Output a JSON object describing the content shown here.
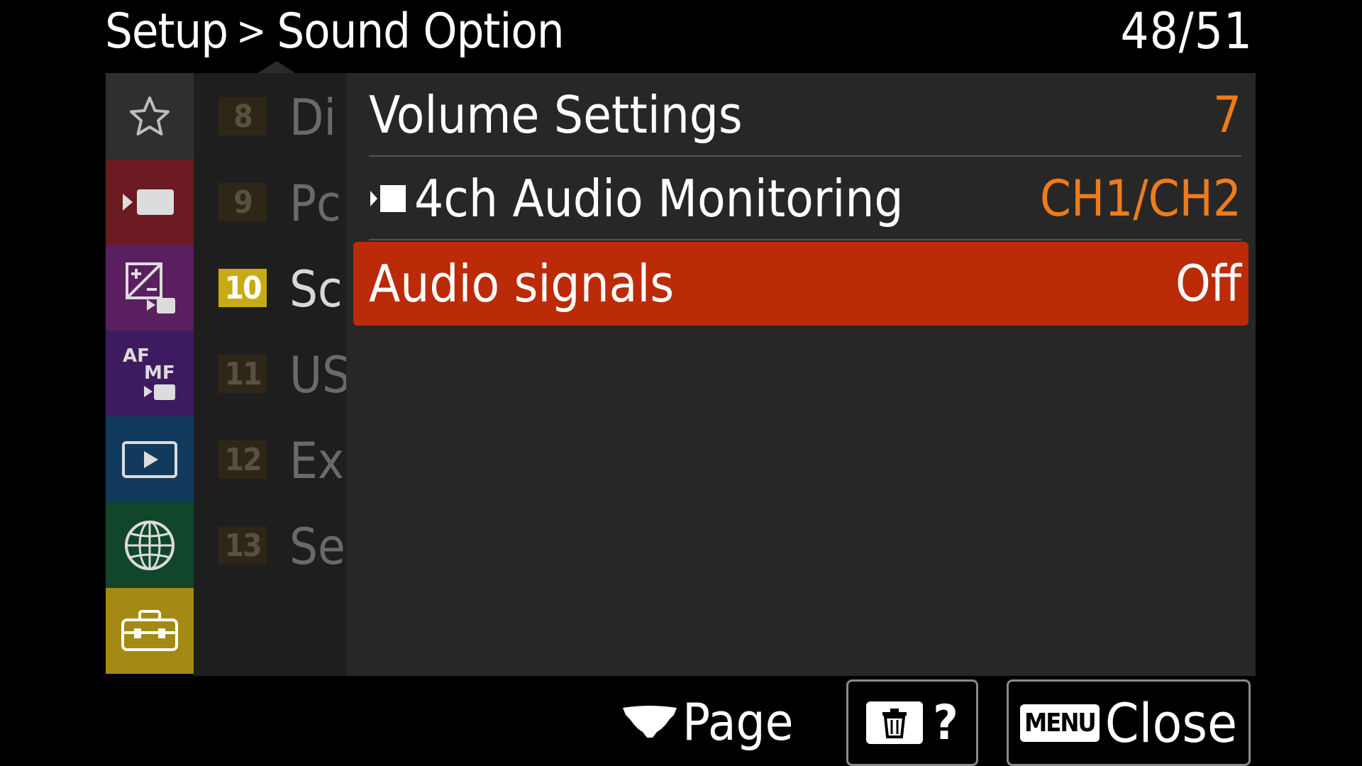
{
  "header": {
    "section": "Setup",
    "separator": ">",
    "page_title": "Sound Option",
    "page_counter": "48/51"
  },
  "categories": [
    {
      "name": "star-icon",
      "color": "#2f2f2f"
    },
    {
      "name": "movie-icon",
      "color": "#6a1a20"
    },
    {
      "name": "exposure-color-icon",
      "color": "#5a1f5e"
    },
    {
      "name": "af-mf-icon",
      "color": "#3e1b60",
      "af": "AF",
      "mf": "MF"
    },
    {
      "name": "playback-icon",
      "color": "#123a5c"
    },
    {
      "name": "network-icon",
      "color": "#12462a"
    },
    {
      "name": "setup-toolbox-icon",
      "color": "#a48a14",
      "active": true
    }
  ],
  "subpages": [
    {
      "number": "8",
      "name": "Di"
    },
    {
      "number": "9",
      "name": "Pc"
    },
    {
      "number": "10",
      "name": "Sc",
      "active": true
    },
    {
      "number": "11",
      "name": "US"
    },
    {
      "number": "12",
      "name": "Ex"
    },
    {
      "number": "13",
      "name": "Se"
    }
  ],
  "menu_items": [
    {
      "label": "Volume Settings",
      "value": "7"
    },
    {
      "label": "4ch Audio Monitoring",
      "value": "CH1/CH2",
      "icon": "movie-icon"
    },
    {
      "label": "Audio signals",
      "value": "Off",
      "selected": true
    }
  ],
  "footer": {
    "page_label": "Page",
    "help_label": "?",
    "menu_key": "MENU",
    "close_label": "Close"
  },
  "colors": {
    "selected_row": "#bb2b07",
    "value_text": "#ef7b1a",
    "active_subpage": "#c8aa14"
  }
}
